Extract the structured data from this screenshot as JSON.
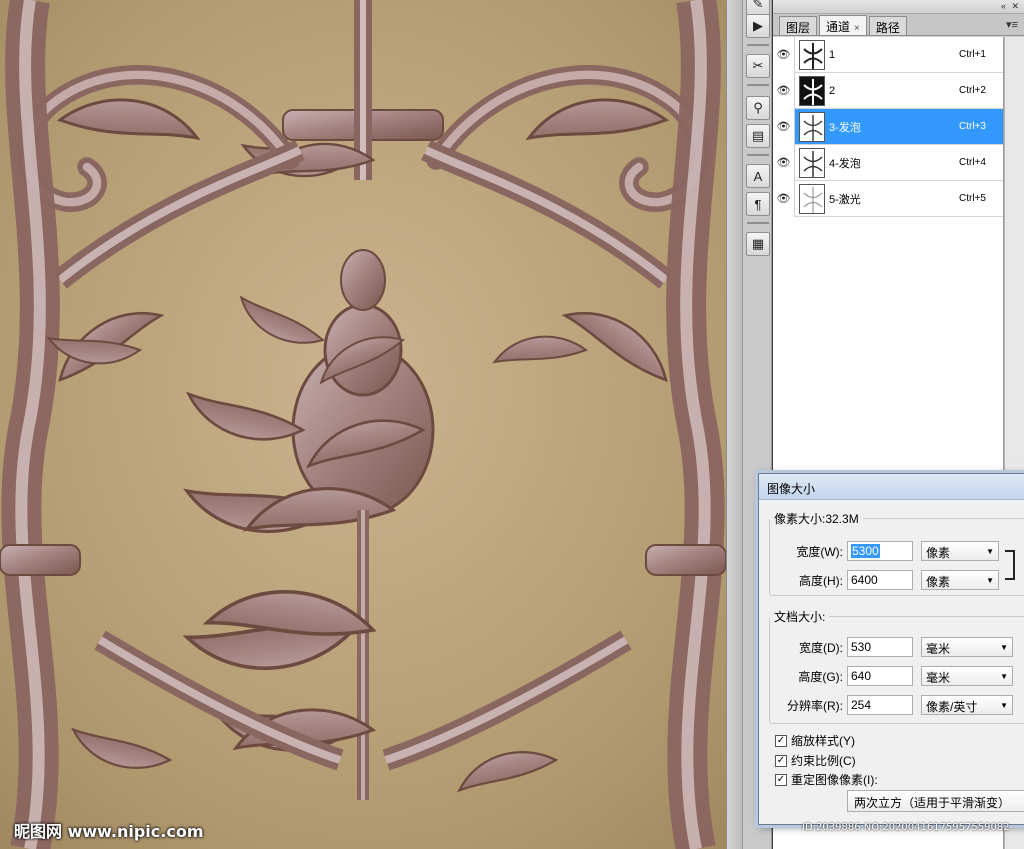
{
  "tabs": [
    {
      "label": "图层"
    },
    {
      "label": "通道",
      "close": "×"
    },
    {
      "label": "路径"
    }
  ],
  "channels": [
    {
      "name": "1",
      "shortcut": "Ctrl+1",
      "selected": false
    },
    {
      "name": "2",
      "shortcut": "Ctrl+2",
      "selected": false
    },
    {
      "name": "3-发泡",
      "shortcut": "Ctrl+3",
      "selected": true
    },
    {
      "name": "4-发泡",
      "shortcut": "Ctrl+4",
      "selected": false
    },
    {
      "name": "5-激光",
      "shortcut": "Ctrl+5",
      "selected": false
    }
  ],
  "dialog": {
    "title": "图像大小",
    "pixel_dim_legend": "像素大小:32.3M",
    "width_label": "宽度(W):",
    "width_value": "5300",
    "width_unit": "像素",
    "height_label": "高度(H):",
    "height_value": "6400",
    "height_unit": "像素",
    "doc_size_legend": "文档大小:",
    "doc_width_label": "宽度(D):",
    "doc_width_value": "530",
    "doc_width_unit": "毫米",
    "doc_height_label": "高度(G):",
    "doc_height_value": "640",
    "doc_height_unit": "毫米",
    "resolution_label": "分辨率(R):",
    "resolution_value": "254",
    "resolution_unit": "像素/英寸",
    "scale_styles": "缩放样式(Y)",
    "constrain": "约束比例(C)",
    "resample": "重定图像像素(I):",
    "interpolation": "两次立方（适用于平滑渐变）"
  },
  "watermark": {
    "left": "昵图网 www.nipic.com",
    "right": "ID:2039886 NO:20200416175957559082"
  },
  "colors": {
    "selection": "#3399ff",
    "canvas_bg": "#b9a27a",
    "ornament": "#8e6a62"
  }
}
